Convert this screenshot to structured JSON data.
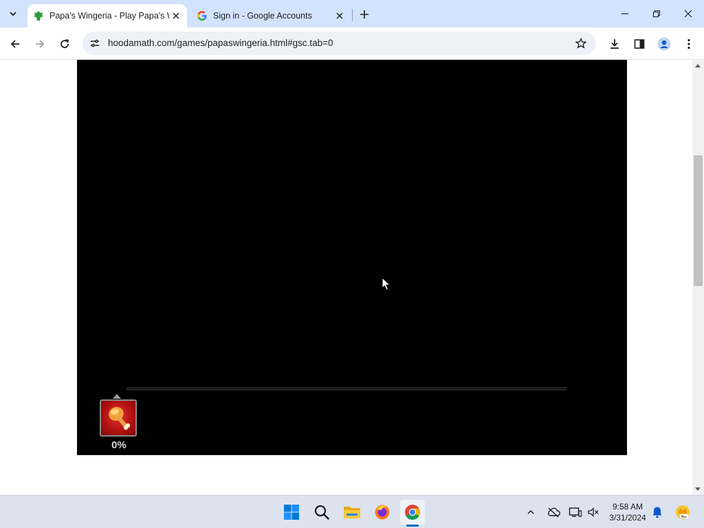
{
  "browser": {
    "tabs": [
      {
        "title": "Papa's Wingeria - Play Papa's Wingeria",
        "active": true,
        "favicon": "hooda-math-icon"
      },
      {
        "title": "Sign in - Google Accounts",
        "active": false,
        "favicon": "google-icon"
      }
    ],
    "url": "hoodamath.com/games/papaswingeria.html#gsc.tab=0",
    "colors": {
      "tabstrip": "#d3e3fd",
      "accent": "#0b57d0"
    }
  },
  "game": {
    "loader_percent_label": "0%",
    "loading_progress": 0,
    "icon": "chicken-wing-icon"
  },
  "taskbar": {
    "apps": [
      "windows-start-icon",
      "search-icon",
      "file-explorer-icon",
      "firefox-icon",
      "chrome-icon"
    ],
    "clock_time": "9:58 AM",
    "clock_date": "3/31/2024"
  }
}
